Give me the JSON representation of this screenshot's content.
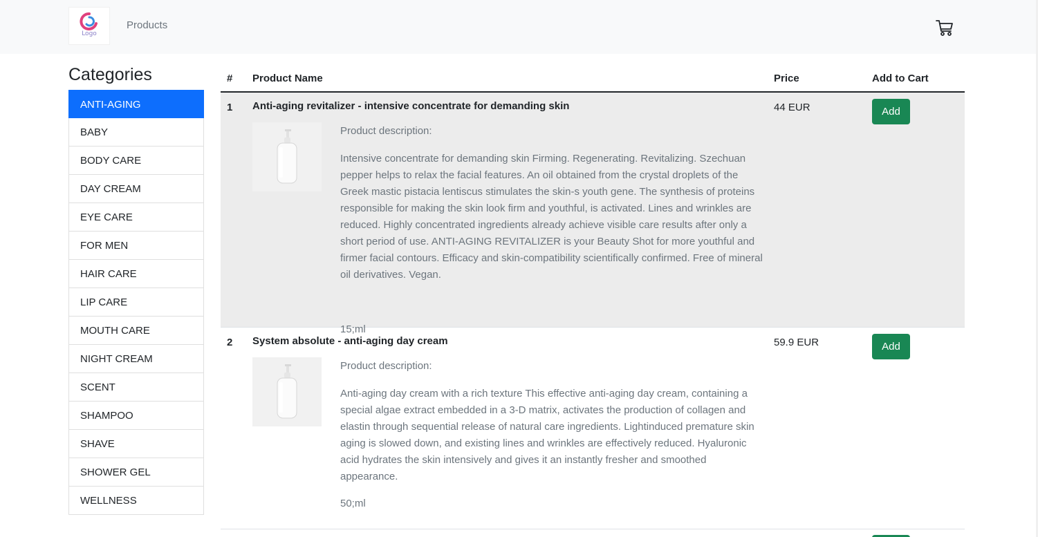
{
  "navbar": {
    "logo_text": "Logo",
    "nav_link": "Products",
    "cart_icon": "shopping-cart-icon"
  },
  "sidebar": {
    "title": "Categories",
    "items": [
      {
        "label": "ANTI-AGING",
        "active": true
      },
      {
        "label": "BABY"
      },
      {
        "label": "BODY CARE"
      },
      {
        "label": "DAY CREAM"
      },
      {
        "label": "EYE CARE"
      },
      {
        "label": "FOR MEN"
      },
      {
        "label": "HAIR CARE"
      },
      {
        "label": "LIP CARE"
      },
      {
        "label": "MOUTH CARE"
      },
      {
        "label": "NIGHT CREAM"
      },
      {
        "label": "SCENT"
      },
      {
        "label": "SHAMPOO"
      },
      {
        "label": "SHAVE"
      },
      {
        "label": "SHOWER GEL"
      },
      {
        "label": "WELLNESS"
      }
    ]
  },
  "table": {
    "headers": {
      "num": "#",
      "name": "Product Name",
      "price": "Price",
      "add": "Add to Cart"
    },
    "rows": [
      {
        "num": "1",
        "name": "Anti-aging revitalizer - intensive concentrate for demanding skin",
        "price": "44 EUR",
        "add_label": "Add",
        "desc_label": "Product description:",
        "description": "Intensive concentrate for demanding skin Firming. Regenerating. Revitalizing. Szechuan pepper helps to relax the facial features. An oil obtained from the crystal droplets of the Greek mastic pistacia lentiscus stimulates the skin-s youth gene. The synthesis of proteins responsible for making the skin look firm and youthful, is activated. Lines and wrinkles are reduced. Highly concentrated ingredients already achieve visible care results after only a short period of use. ANTI-AGING REVITALIZER is your Beauty Shot for more youthful and firmer facial contours. Efficacy and skin-compatibility scientifically confirmed. Free of mineral oil derivatives. Vegan.",
        "size": "15;ml"
      },
      {
        "num": "2",
        "name": "System absolute - anti-aging day cream",
        "price": "59.9 EUR",
        "add_label": "Add",
        "desc_label": "Product description:",
        "description": "Anti-aging day cream with a rich texture This effective anti-aging day cream, containing a special algae extract embedded in a 3-D matrix, activates the production of collagen and elastin through sequential release of natural care ingredients. Lightinduced premature skin aging is slowed down, and existing lines and wrinkles are effectively reduced. Hyaluronic acid hydrates the skin intensively and gives it an instantly fresher and smoothed appearance.",
        "size": "50;ml"
      }
    ]
  },
  "colors": {
    "active_category": "#0d6efd",
    "add_button": "#198754",
    "navbar_bg": "#f8f9fa",
    "striped_row": "#ececec"
  }
}
